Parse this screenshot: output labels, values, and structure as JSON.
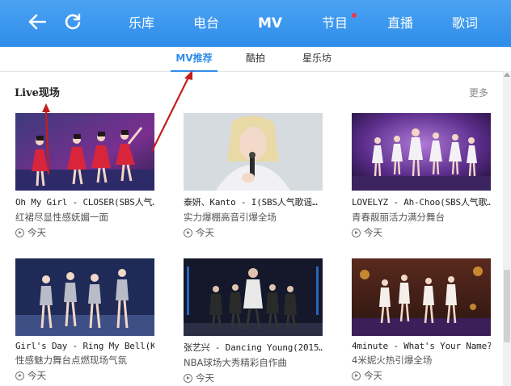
{
  "topbar": {
    "back_icon": "arrow-left-icon",
    "refresh_icon": "refresh-icon",
    "nav": [
      {
        "label": "乐库"
      },
      {
        "label": "电台"
      },
      {
        "label": "MV"
      },
      {
        "label": "节目"
      },
      {
        "label": "直播"
      },
      {
        "label": "歌词"
      }
    ],
    "active": "MV",
    "accent": "#2f8de9",
    "badge_color": "#f2364b"
  },
  "subtabs": [
    {
      "label": "MV推荐"
    },
    {
      "label": "酷拍"
    },
    {
      "label": "星乐坊"
    }
  ],
  "section": {
    "title": "Live现场",
    "more": "更多"
  },
  "videos": [
    {
      "title": "Oh My Girl - CLOSER(SBS人气…",
      "desc": "红裙尽显性感妩媚一面",
      "date": "今天"
    },
    {
      "title": "泰妍、Kanto - I(SBS人气歌谣…",
      "desc": "实力爆棚高音引爆全场",
      "date": "今天"
    },
    {
      "title": "LOVELYZ - Ah-Choo(SBS人气歌…",
      "desc": "青春靓丽活力满分舞台",
      "date": "今天"
    },
    {
      "title": "Girl's Day - Ring My Bell(K…",
      "desc": "性感魅力舞台点燃现场气氛",
      "date": "今天"
    },
    {
      "title": "张艺兴 - Dancing Young(2015…",
      "desc": "NBA球场大秀精彩自作曲",
      "date": "今天"
    },
    {
      "title": "4minute - What's Your Name?…",
      "desc": "4米妮火热引爆全场",
      "date": "今天"
    }
  ]
}
